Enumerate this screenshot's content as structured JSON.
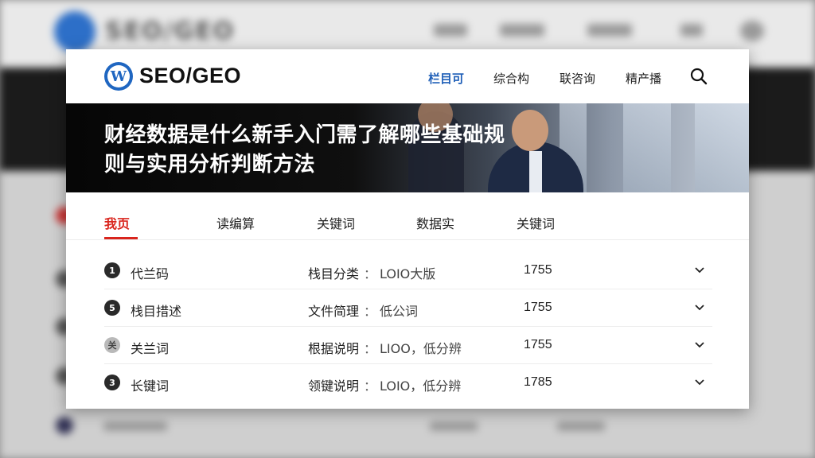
{
  "background": {
    "brand": "SEO/GEO"
  },
  "header": {
    "brand": "SEO/GEO",
    "logo_icon": "wordpress-logo-icon",
    "nav": [
      {
        "label": "栏目可",
        "active": true
      },
      {
        "label": "综合构",
        "active": false
      },
      {
        "label": "联咨询",
        "active": false
      },
      {
        "label": "精产播",
        "active": false
      }
    ],
    "search_icon": "search-icon"
  },
  "banner": {
    "title": "财经数据是什么新手入门需了解哪些基础规则与实用分析判断方法"
  },
  "tabs": [
    {
      "label": "我页",
      "active": true
    },
    {
      "label": "读编算",
      "active": false
    },
    {
      "label": "关键词",
      "active": false
    },
    {
      "label": "数据实",
      "active": false
    },
    {
      "label": "关键词",
      "active": false
    }
  ],
  "rows": [
    {
      "icon_glyph": "1",
      "label": "代兰码",
      "key": "栈目分类",
      "colon": "：",
      "value": "LOIO大版",
      "number": "1755"
    },
    {
      "icon_glyph": "5",
      "label": "栈目措述",
      "key": "文件简理",
      "colon": "：",
      "value": "低公词",
      "number": "1755"
    },
    {
      "icon_glyph": "关",
      "label": "关兰词",
      "key": "根据说明",
      "colon": "：",
      "value": "LIOO，低分辨",
      "number": "1755"
    },
    {
      "icon_glyph": "3",
      "label": "长键词",
      "key": "领键说明",
      "colon": "：",
      "value": "LOIO，低分辨",
      "number": "1785"
    }
  ],
  "colors": {
    "accent_blue": "#1f5fb8",
    "accent_red": "#d9251d"
  }
}
